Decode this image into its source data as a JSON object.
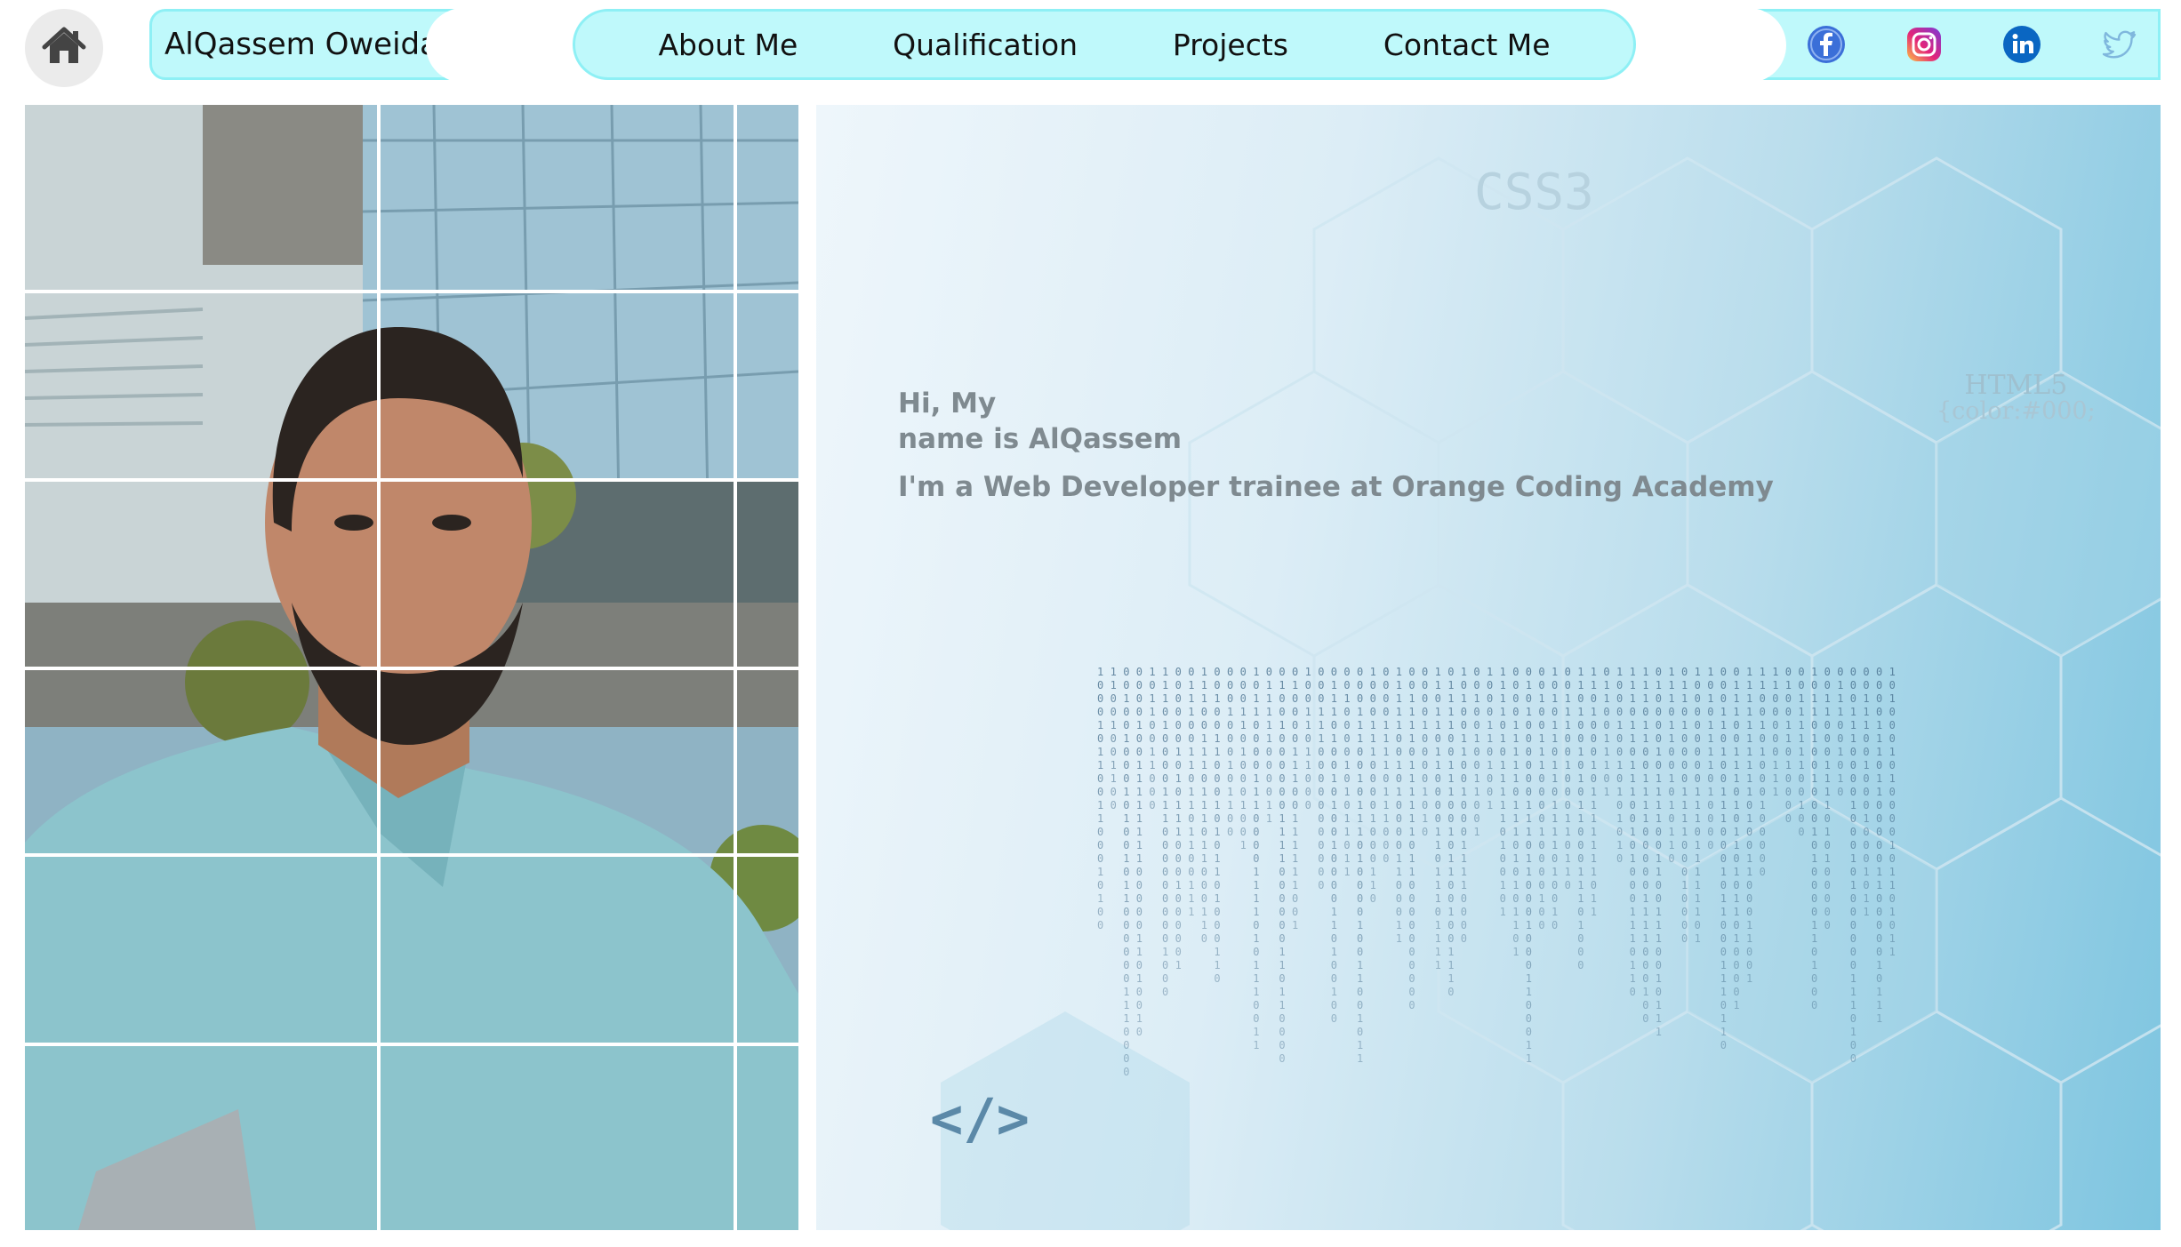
{
  "header": {
    "home_icon": "home-icon",
    "brand": "AlQassem Oweida",
    "nav": [
      {
        "label": "About Me"
      },
      {
        "label": "Qualification"
      },
      {
        "label": "Projects"
      },
      {
        "label": "Contact Me"
      }
    ],
    "social": [
      {
        "icon": "facebook-icon",
        "color": "#3b6fd8"
      },
      {
        "icon": "instagram-icon",
        "color": "#d6298f"
      },
      {
        "icon": "linkedin-icon",
        "color": "#0a66c2"
      },
      {
        "icon": "twitter-icon",
        "color": "#7fb7dd"
      }
    ]
  },
  "hero": {
    "greeting_line1": "Hi, My",
    "greeting_line2": "name is AlQassem",
    "tagline": "I'm a Web Developer trainee at Orange Coding Academy",
    "bg_label_css": "CSS3",
    "bg_label_html": "HTML5",
    "bg_code": "{color:#000;",
    "code_tag": "</>"
  },
  "colors": {
    "accent_bar": "#bff9fb",
    "accent_border": "#8ef0f5",
    "hero_text": "#7f8a90"
  }
}
